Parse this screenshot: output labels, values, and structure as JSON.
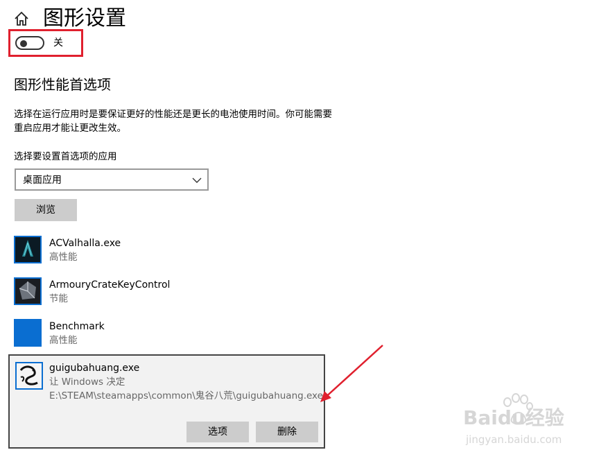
{
  "page": {
    "title": "图形设置"
  },
  "toggle": {
    "label": "关",
    "state": "off"
  },
  "section": {
    "title": "图形性能首选项",
    "description": "选择在运行应用时是要保证更好的性能还是更长的电池使用时间。你可能需要重启应用才能让更改生效。"
  },
  "app_select": {
    "label": "选择要设置首选项的应用",
    "value": "桌面应用"
  },
  "browse_label": "浏览",
  "apps": [
    {
      "name": "ACValhalla.exe",
      "preference": "高性能",
      "icon": "assassins-creed-icon"
    },
    {
      "name": "ArmouryCrateKeyControl",
      "preference": "节能",
      "icon": "armoury-crate-icon"
    },
    {
      "name": "Benchmark",
      "preference": "高性能",
      "icon": "blank-app-icon"
    },
    {
      "name": "guigubahuang.exe",
      "preference": "让 Windows 决定",
      "path": "E:\\STEAM\\steamapps\\common\\鬼谷八荒\\guigubahuang.exe",
      "icon": "dragon-icon"
    }
  ],
  "actions": {
    "options": "选项",
    "delete": "删除"
  },
  "watermark": {
    "brand": "Baidu经验",
    "url": "jingyan.baidu.com"
  },
  "colors": {
    "highlight": "#e0202e",
    "app_blue": "#0a6ed1",
    "button_gray": "#cccccc",
    "panel_bg": "#f2f2f2"
  }
}
